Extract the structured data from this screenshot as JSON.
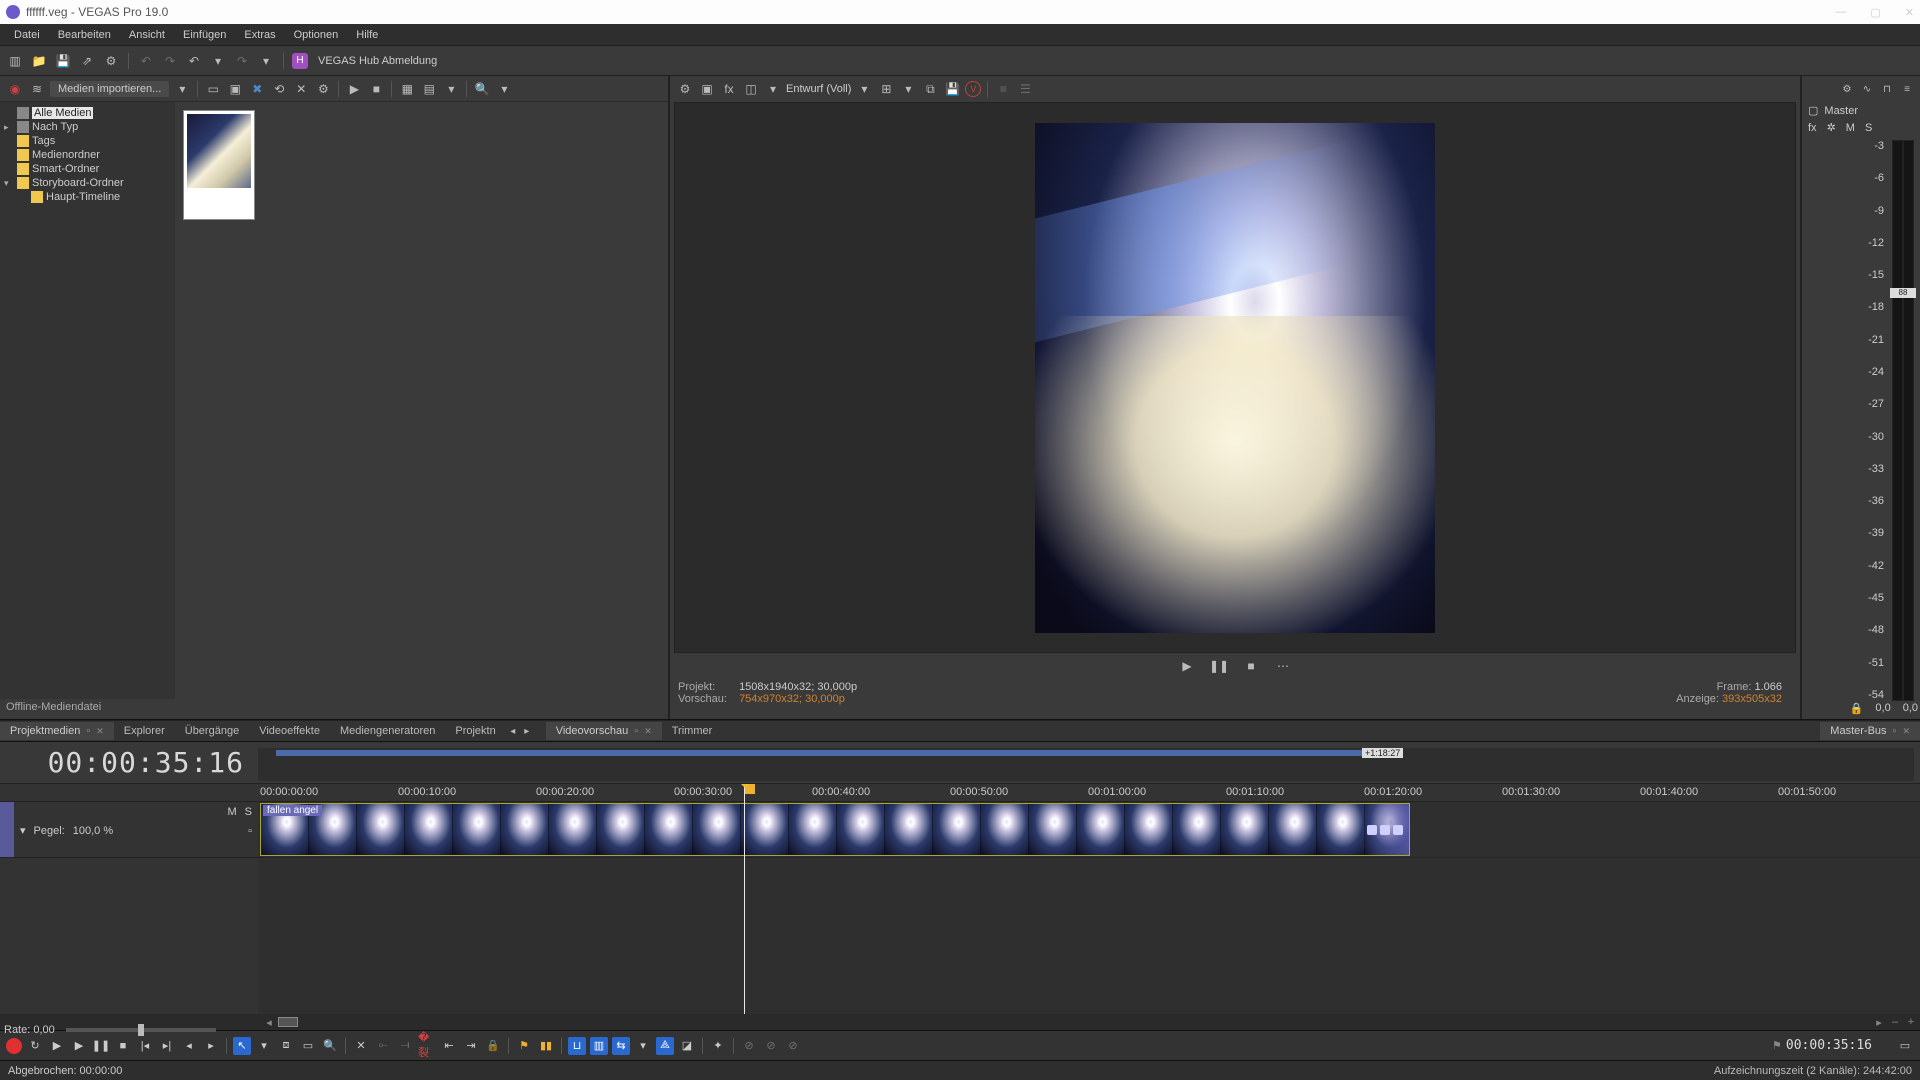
{
  "title": "ffffff.veg - VEGAS Pro 19.0",
  "menu": [
    "Datei",
    "Bearbeiten",
    "Ansicht",
    "Einfügen",
    "Extras",
    "Optionen",
    "Hilfe"
  ],
  "hub": "VEGAS Hub Abmeldung",
  "media": {
    "import_label": "Medien importieren...",
    "tree": [
      {
        "label": "Alle Medien",
        "sel": true,
        "icon": "film"
      },
      {
        "label": "Nach Typ",
        "icon": "film",
        "toggle": "+"
      },
      {
        "label": "Tags",
        "icon": "folder"
      },
      {
        "label": "Medienordner",
        "icon": "folder"
      },
      {
        "label": "Smart-Ordner",
        "icon": "folder"
      },
      {
        "label": "Storyboard-Ordner",
        "icon": "folder",
        "toggle": "-"
      },
      {
        "label": "Haupt-Timeline",
        "icon": "folder",
        "indent": 1
      }
    ],
    "status": "Offline-Mediendatei"
  },
  "tabs_left": [
    "Projektmedien",
    "Explorer",
    "Übergänge",
    "Videoeffekte",
    "Mediengeneratoren",
    "Projektn"
  ],
  "tabs_mid": [
    "Videovorschau",
    "Trimmer"
  ],
  "tabs_right": [
    "Master-Bus"
  ],
  "preview": {
    "quality": "Entwurf (Voll)",
    "info": {
      "projekt_k": "Projekt:",
      "projekt_v": "1508x1940x32; 30,000p",
      "vorschau_k": "Vorschau:",
      "vorschau_v": "754x970x32; 30,000p",
      "frame_k": "Frame:",
      "frame_v": "1.066",
      "anzeige_k": "Anzeige:",
      "anzeige_v": "393x505x32"
    }
  },
  "master": {
    "label": "Master",
    "scale": [
      "-3",
      "-6",
      "-9",
      "-12",
      "-15",
      "-18",
      "-21",
      "-24",
      "-27",
      "-30",
      "-33",
      "-36",
      "-39",
      "-42",
      "-45",
      "-48",
      "-51",
      "-54"
    ],
    "peak": "88",
    "foot_l": "0,0",
    "foot_r": "0,0"
  },
  "timeline": {
    "timecode": "00:00:35:16",
    "overview_tag": "+1:18:27",
    "ruler": [
      "00:00:00:00",
      "00:00:10:00",
      "00:00:20:00",
      "00:00:30:00",
      "00:00:40:00",
      "00:00:50:00",
      "00:01:00:00",
      "00:01:10:00",
      "00:01:20:00",
      "00:01:30:00",
      "00:01:40:00",
      "00:01:50:00"
    ],
    "track": {
      "pegel_k": "Pegel:",
      "pegel_v": "100,0 %",
      "m": "M",
      "s": "S"
    },
    "clip_label": "fallen angel"
  },
  "rate": {
    "label": "Rate: 0,00"
  },
  "transport": {
    "timecode": "00:00:35:16"
  },
  "status": {
    "left": "Abgebrochen: 00:00:00",
    "right": "Aufzeichnungszeit (2 Kanäle): 244:42:00"
  }
}
